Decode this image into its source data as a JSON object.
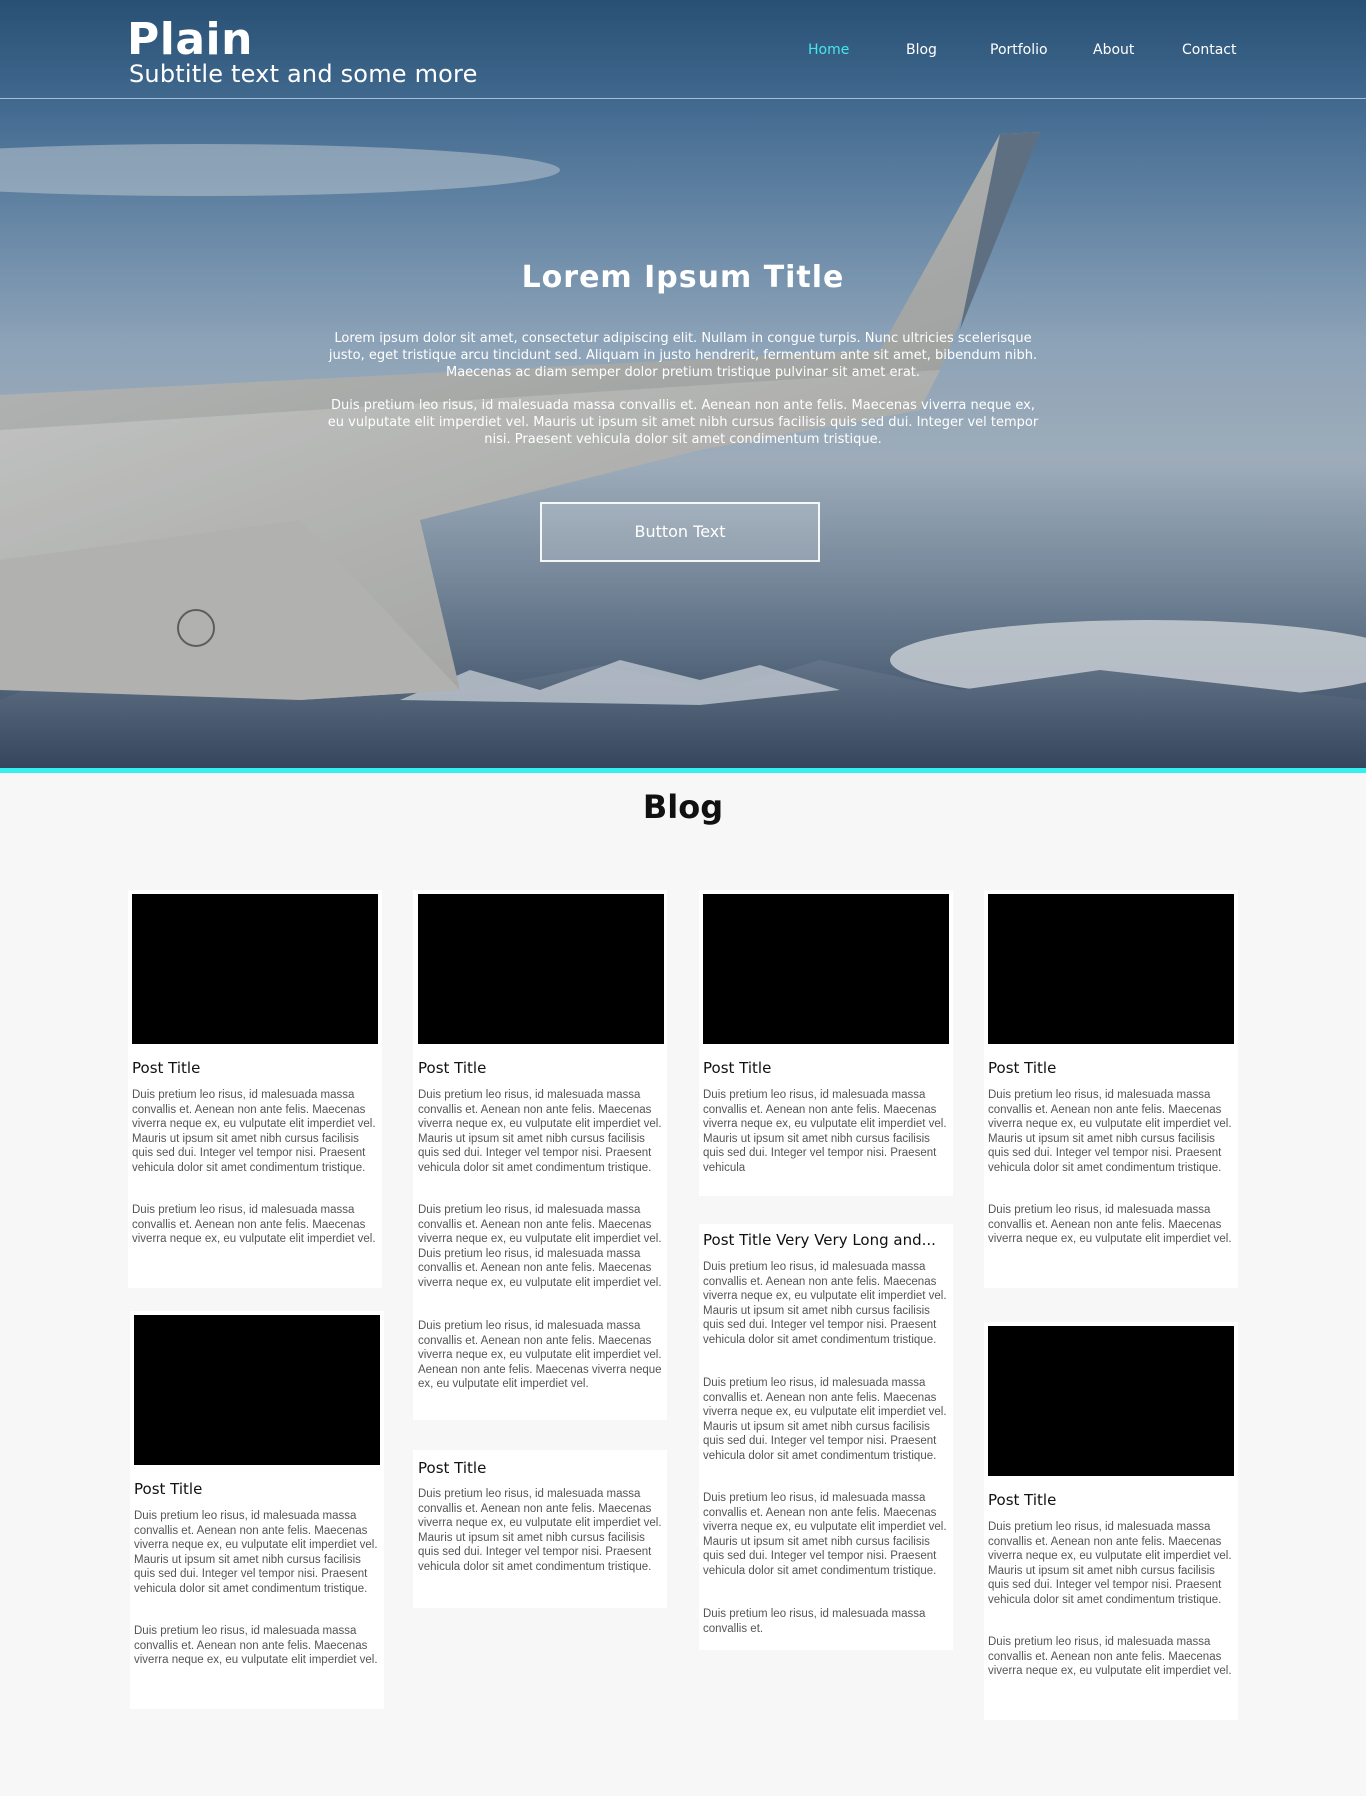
{
  "header": {
    "brand_title": "Plain",
    "brand_subtitle": "Subtitle text and some more",
    "nav": [
      {
        "label": "Home",
        "active": true
      },
      {
        "label": "Blog",
        "active": false
      },
      {
        "label": "Portfolio",
        "active": false
      },
      {
        "label": "About",
        "active": false
      },
      {
        "label": "Contact",
        "active": false
      }
    ]
  },
  "hero": {
    "title": "Lorem Ipsum Title",
    "paragraph_1": "Lorem ipsum dolor sit amet, consectetur adipiscing elit. Nullam in congue turpis. Nunc ultricies scelerisque justo, eget tristique arcu tincidunt sed. Aliquam in justo hendrerit, fermentum ante sit amet, bibendum nibh. Maecenas ac diam semper dolor pretium tristique pulvinar sit amet erat.",
    "paragraph_2": "Duis pretium leo risus, id malesuada massa convallis et. Aenean non ante felis. Maecenas viverra neque ex, eu vulputate elit imperdiet vel. Mauris ut ipsum sit amet nibh cursus facilisis quis sed dui. Integer vel tempor nisi. Praesent vehicula dolor sit amet condimentum tristique.",
    "button_label": "Button Text"
  },
  "blog": {
    "heading": "Blog",
    "posts": [
      {
        "title": "Post Title",
        "body_1": "Duis pretium leo risus, id malesuada massa convallis et. Aenean non ante felis. Maecenas viverra neque ex, eu vulputate elit imperdiet vel. Mauris ut ipsum sit amet nibh cursus facilisis quis sed dui. Integer vel tempor nisi. Praesent vehicula dolor sit amet condimentum tristique.",
        "body_2": "Duis pretium leo risus, id malesuada massa convallis et. Aenean non ante felis. Maecenas viverra neque ex, eu vulputate elit imperdiet vel."
      },
      {
        "title": "Post Title",
        "body_1": "Duis pretium leo risus, id malesuada massa convallis et. Aenean non ante felis. Maecenas viverra neque ex, eu vulputate elit imperdiet vel. Mauris ut ipsum sit amet nibh cursus facilisis quis sed dui. Integer vel tempor nisi. Praesent vehicula dolor sit amet condimentum tristique.",
        "body_2": "Duis pretium leo risus, id malesuada massa convallis et. Aenean non ante felis. Maecenas viverra neque ex, eu vulputate elit imperdiet vel. Duis pretium leo risus, id malesuada massa convallis et. Aenean non ante felis. Maecenas viverra neque ex, eu vulputate elit imperdiet vel.",
        "body_3": "Duis pretium leo risus, id malesuada massa convallis et. Aenean non ante felis. Maecenas viverra neque ex, eu vulputate elit imperdiet vel. Aenean non ante felis. Maecenas viverra neque ex, eu vulputate elit imperdiet vel."
      },
      {
        "title": "Post Title",
        "body_1": "Duis pretium leo risus, id malesuada massa convallis et. Aenean non ante felis. Maecenas viverra neque ex, eu vulputate elit imperdiet vel. Mauris ut ipsum sit amet nibh cursus facilisis quis sed dui. Integer vel tempor nisi. Praesent vehicula"
      },
      {
        "title": "Post Title",
        "body_1": "Duis pretium leo risus, id malesuada massa convallis et. Aenean non ante felis. Maecenas viverra neque ex, eu vulputate elit imperdiet vel. Mauris ut ipsum sit amet nibh cursus facilisis quis sed dui. Integer vel tempor nisi. Praesent vehicula dolor sit amet condimentum tristique.",
        "body_2": "Duis pretium leo risus, id malesuada massa convallis et. Aenean non ante felis. Maecenas viverra neque ex, eu vulputate elit imperdiet vel."
      },
      {
        "title": "Post Title",
        "body_1": "Duis pretium leo risus, id malesuada massa convallis et. Aenean non ante felis. Maecenas viverra neque ex, eu vulputate elit imperdiet vel. Mauris ut ipsum sit amet nibh cursus facilisis quis sed dui. Integer vel tempor nisi. Praesent vehicula dolor sit amet condimentum tristique.",
        "body_2": "Duis pretium leo risus, id malesuada massa convallis et. Aenean non ante felis. Maecenas viverra neque ex, eu vulputate elit imperdiet vel."
      },
      {
        "title": "Post Title",
        "body_1": "Duis pretium leo risus, id malesuada massa convallis et. Aenean non ante felis. Maecenas viverra neque ex, eu vulputate elit imperdiet vel. Mauris ut ipsum sit amet nibh cursus facilisis quis sed dui. Integer vel tempor nisi. Praesent vehicula dolor sit amet condimentum tristique."
      },
      {
        "title": "Post Title Very Very Long and...",
        "body_1": "Duis pretium leo risus, id malesuada massa convallis et. Aenean non ante felis. Maecenas viverra neque ex, eu vulputate elit imperdiet vel. Mauris ut ipsum sit amet nibh cursus facilisis quis sed dui. Integer vel tempor nisi. Praesent vehicula dolor sit amet condimentum tristique.",
        "body_2": "Duis pretium leo risus, id malesuada massa convallis et. Aenean non ante felis. Maecenas viverra neque ex, eu vulputate elit imperdiet vel. Mauris ut ipsum sit amet nibh cursus facilisis quis sed dui. Integer vel tempor nisi. Praesent vehicula dolor sit amet condimentum tristique.",
        "body_3": "Duis pretium leo risus, id malesuada massa convallis et. Aenean non ante felis. Maecenas viverra neque ex, eu vulputate elit imperdiet vel. Mauris ut ipsum sit amet nibh cursus facilisis quis sed dui. Integer vel tempor nisi. Praesent vehicula dolor sit amet condimentum tristique.",
        "body_4": "Duis pretium leo risus, id malesuada massa convallis et."
      },
      {
        "title": "Post Title",
        "body_1": "Duis pretium leo risus, id malesuada massa convallis et. Aenean non ante felis. Maecenas viverra neque ex, eu vulputate elit imperdiet vel. Mauris ut ipsum sit amet nibh cursus facilisis quis sed dui. Integer vel tempor nisi. Praesent vehicula dolor sit amet condimentum tristique.",
        "body_2": "Duis pretium leo risus, id malesuada massa convallis et. Aenean non ante felis. Maecenas viverra neque ex, eu vulputate elit imperdiet vel."
      }
    ]
  }
}
